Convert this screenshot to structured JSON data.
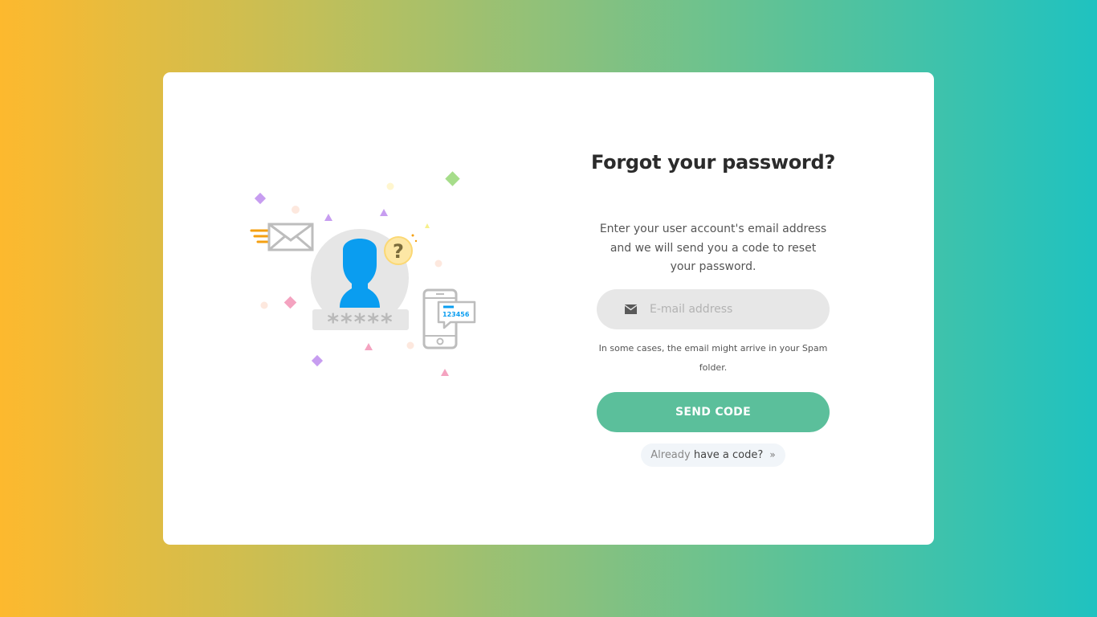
{
  "form": {
    "title": "Forgot your password?",
    "description": "Enter your user account's email address and we will send you a code to reset your password.",
    "email": {
      "placeholder": "E-mail address",
      "value": "",
      "icon": "envelope-icon"
    },
    "note": "In some cases, the email might arrive in your Spam folder.",
    "send_label": "SEND CODE",
    "code_link": {
      "prefix": "Already",
      "label": "have a code?",
      "icon": "double-chevron-right-icon"
    }
  },
  "illustration": {
    "password_mask": "*****",
    "sms_code": "123456"
  },
  "colors": {
    "primary": "#5bbf9b",
    "avatar": "#0a9df0",
    "gradient_start": "#fdb92e",
    "gradient_end": "#1fc2c0"
  }
}
